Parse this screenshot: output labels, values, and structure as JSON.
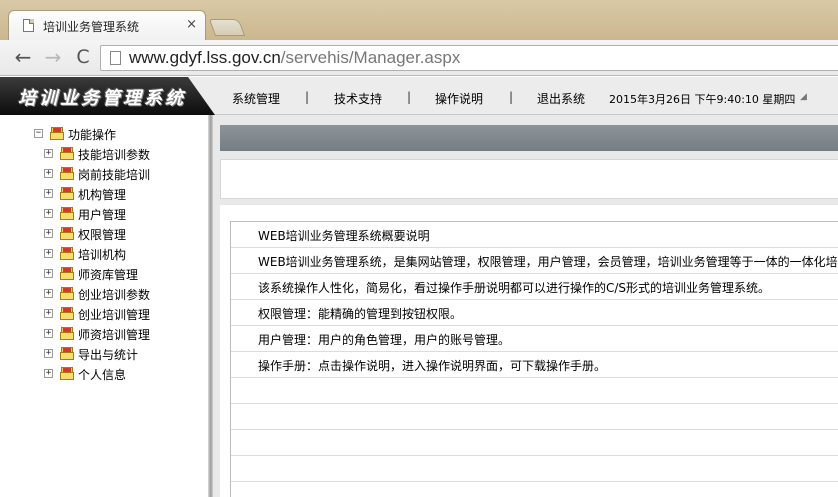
{
  "browser": {
    "tab_title": "培训业务管理系统",
    "close_glyph": "×",
    "url_host": "www.gdyf.lss.gov.cn",
    "url_path": "/servehis/Manager.aspx",
    "back_glyph": "←",
    "forward_glyph": "→",
    "reload_glyph": "C"
  },
  "header": {
    "logo_text": "培训业务管理系统",
    "nav": [
      "系统管理",
      "技术支持",
      "操作说明",
      "退出系统"
    ],
    "separator": "|",
    "datetime": "2015年3月26日 下午9:40:10 星期四"
  },
  "sidebar": {
    "root": {
      "label": "功能操作",
      "expander": "⊟"
    },
    "items": [
      {
        "label": "技能培训参数"
      },
      {
        "label": "岗前技能培训"
      },
      {
        "label": "机构管理"
      },
      {
        "label": "用户管理"
      },
      {
        "label": "权限管理"
      },
      {
        "label": "培训机构"
      },
      {
        "label": "师资库管理"
      },
      {
        "label": "创业培训参数"
      },
      {
        "label": "创业培训管理"
      },
      {
        "label": "师资培训管理"
      },
      {
        "label": "导出与统计"
      },
      {
        "label": "个人信息"
      }
    ],
    "item_expander": "+"
  },
  "main": {
    "rows": [
      "WEB培训业务管理系统概要说明",
      "WEB培训业务管理系统，是集网站管理，权限管理，用户管理，会员管理，培训业务管理等于一体的一体化培训",
      "该系统操作人性化，简易化，看过操作手册说明都可以进行操作的C/S形式的培训业务管理系统。",
      "权限管理：能精确的管理到按钮权限。",
      "用户管理：用户的角色管理，用户的账号管理。",
      "操作手册：点击操作说明，进入操作说明界面，可下载操作手册。",
      "",
      "",
      "",
      "",
      ""
    ]
  }
}
